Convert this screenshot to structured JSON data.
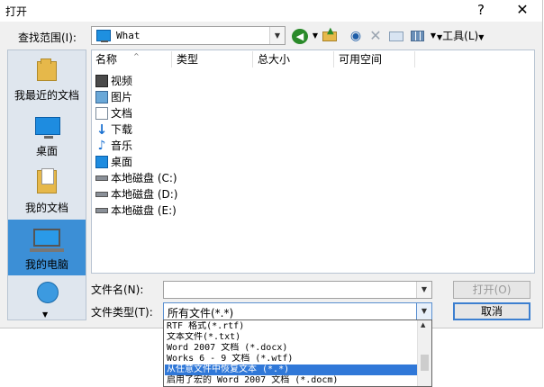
{
  "window": {
    "title": "打开",
    "help": "?",
    "close": "✕"
  },
  "lookin": {
    "label": "查找范围(I):",
    "value": "What"
  },
  "toolbar": {
    "tools_label": "工具(L)"
  },
  "places": [
    {
      "label": "我最近的文档"
    },
    {
      "label": "桌面"
    },
    {
      "label": "我的文档"
    },
    {
      "label": "我的电脑"
    },
    {
      "label": ""
    }
  ],
  "columns": [
    "名称",
    "类型",
    "总大小",
    "可用空间"
  ],
  "items": [
    {
      "name": "视频",
      "icon": "video-folder-icon"
    },
    {
      "name": "图片",
      "icon": "pictures-folder-icon"
    },
    {
      "name": "文档",
      "icon": "documents-folder-icon"
    },
    {
      "name": "下载",
      "icon": "downloads-folder-icon"
    },
    {
      "name": "音乐",
      "icon": "music-folder-icon"
    },
    {
      "name": "桌面",
      "icon": "desktop-folder-icon"
    },
    {
      "name": "本地磁盘 (C:)",
      "icon": "drive-icon"
    },
    {
      "name": "本地磁盘 (D:)",
      "icon": "drive-icon"
    },
    {
      "name": "本地磁盘 (E:)",
      "icon": "drive-icon"
    }
  ],
  "filename": {
    "label": "文件名(N):",
    "value": ""
  },
  "filetype": {
    "label": "文件类型(T):",
    "value": "所有文件(*.*)",
    "options": [
      "RTF 格式(*.rtf)",
      "文本文件(*.txt)",
      "Word 2007 文档 (*.docx)",
      "Works 6 - 9 文档 (*.wtf)",
      "从任意文件中恢复文本 (*.*)",
      "启用了宏的 Word 2007 文档 (*.docm)"
    ],
    "selected_index": 4
  },
  "buttons": {
    "open": "打开(O)",
    "cancel": "取消"
  },
  "colors": {
    "selection": "#3078d8",
    "active_place": "#3c8fd6"
  }
}
